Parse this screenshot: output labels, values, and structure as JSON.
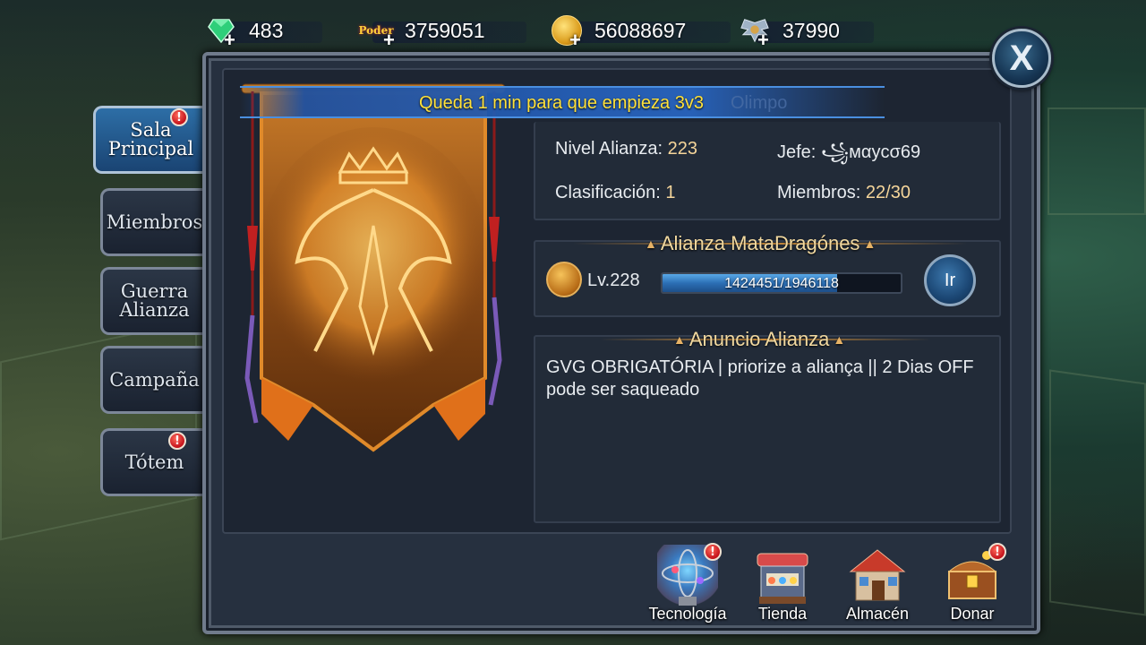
{
  "resources": [
    {
      "icon": "gem-icon",
      "value": "483"
    },
    {
      "icon": "power-icon",
      "value": "3759051",
      "icon_text": "Poder"
    },
    {
      "icon": "gold-coin-icon",
      "value": "56088697"
    },
    {
      "icon": "honor-wings-icon",
      "value": "37990"
    }
  ],
  "close": {
    "label": "X"
  },
  "tabs": [
    {
      "label": "Sala Principal",
      "active": true,
      "badge": true
    },
    {
      "label": "Miembros",
      "active": false,
      "badge": false
    },
    {
      "label": "Guerra Alianza",
      "active": false,
      "badge": false
    },
    {
      "label": "Campaña",
      "active": false,
      "badge": false
    },
    {
      "label": "Tótem",
      "active": false,
      "badge": true
    }
  ],
  "notification": {
    "text": "Queda 1 min para que empieza 3v3",
    "ghost_text": "Olimpo"
  },
  "info": {
    "level_label": "Nivel Alianza:",
    "level_value": "223",
    "rank_label": "Clasificación:",
    "rank_value": "1",
    "leader_label": "Jefe:",
    "leader_value": "꧁мαуcσ69",
    "members_label": "Miembros:",
    "members_value": "22/30"
  },
  "alliance": {
    "title": "Alianza MataDragónes",
    "level": "Lv.228",
    "progress_text": "1424451/1946118",
    "progress_fraction": 0.732,
    "go_label": "Ir"
  },
  "announcement": {
    "title": "Anuncio Alianza",
    "text": "GVG OBRIGATÓRIA | priorize a aliança ||  2 Dias OFF pode ser saqueado"
  },
  "bottom_actions": [
    {
      "label": "Tecnología",
      "icon": "technology-orb-icon",
      "badge": true
    },
    {
      "label": "Tienda",
      "icon": "shop-stall-icon",
      "badge": false
    },
    {
      "label": "Almacén",
      "icon": "warehouse-icon",
      "badge": false
    },
    {
      "label": "Donar",
      "icon": "treasure-chest-icon",
      "badge": true
    }
  ],
  "colors": {
    "accent_gold": "#f5d59a",
    "ribbon_text": "#ffe13a",
    "active_tab": "#2d6ea6"
  }
}
